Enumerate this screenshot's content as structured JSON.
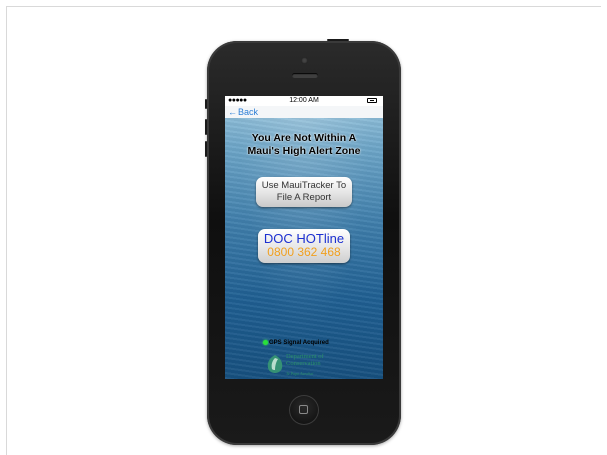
{
  "status_bar": {
    "signal": "●●●●●",
    "time": "12:00 AM",
    "battery_icon": "battery-icon"
  },
  "nav": {
    "back_label": "Back",
    "back_icon": "arrow-left-icon"
  },
  "alert": {
    "line1": "You Are Not Within A",
    "line2": "Maui's High Alert Zone"
  },
  "report_button": {
    "line1": "Use MauiTracker To",
    "line2": "File A Report"
  },
  "hotline_button": {
    "title": "DOC HOTline",
    "number": "0800 362 468"
  },
  "gps": {
    "status_text": "GPS Signal Acquired",
    "indicator_color": "#29e03a"
  },
  "logo": {
    "line1": "Department of",
    "line2": "Conservation",
    "maori": "Te Papa Atawhai"
  },
  "colors": {
    "hotline_title": "#1b2fd0",
    "hotline_number": "#f0a020",
    "back_link": "#2d7fd6",
    "doc_green": "#2a8f6a"
  }
}
